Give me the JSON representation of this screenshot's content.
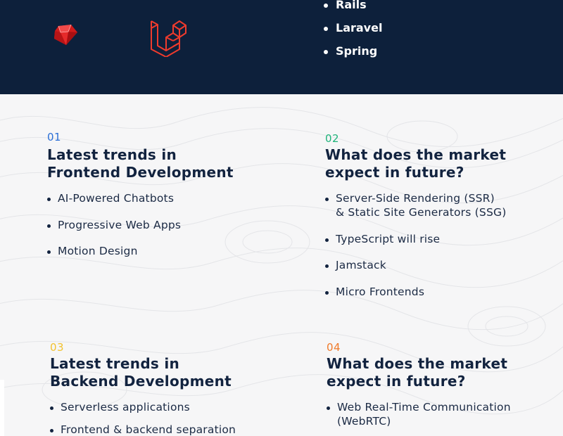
{
  "hero": {
    "logos": [
      "ruby-logo",
      "laravel-logo"
    ],
    "frameworks": [
      "Rails",
      "Laravel",
      "Spring"
    ]
  },
  "sections": [
    {
      "number": "01",
      "number_color": "#2b6fd6",
      "title_line1": "Latest trends in",
      "title_line2": "Frontend Development",
      "items": [
        "AI-Powered Chatbots",
        "Progressive Web Apps",
        "Motion Design"
      ]
    },
    {
      "number": "02",
      "number_color": "#1fb37a",
      "title_line1": "What does the market",
      "title_line2": "expect in future?",
      "items": [
        {
          "line1": "Server-Side Rendering (SSR)",
          "line2": "& Static Site Generators (SSG)"
        },
        {
          "line1": "TypeScript will rise"
        },
        {
          "line1": "Jamstack"
        },
        {
          "line1": "Micro Frontends"
        }
      ]
    },
    {
      "number": "03",
      "number_color": "#f2c230",
      "title_line1": "Latest trends in",
      "title_line2": "Backend Development",
      "items": [
        "Serverless applications",
        "Frontend & backend separation"
      ]
    },
    {
      "number": "04",
      "number_color": "#f07a2a",
      "title_line1": "What does the market",
      "title_line2": "expect in future?",
      "items": [
        {
          "line1": "Web Real-Time Communication",
          "line2": "(WebRTC)"
        }
      ]
    }
  ],
  "colors": {
    "hero_bg": "#0d203b",
    "heading": "#12233f",
    "ruby": "#d11a1a",
    "laravel": "#ef3b2d"
  }
}
